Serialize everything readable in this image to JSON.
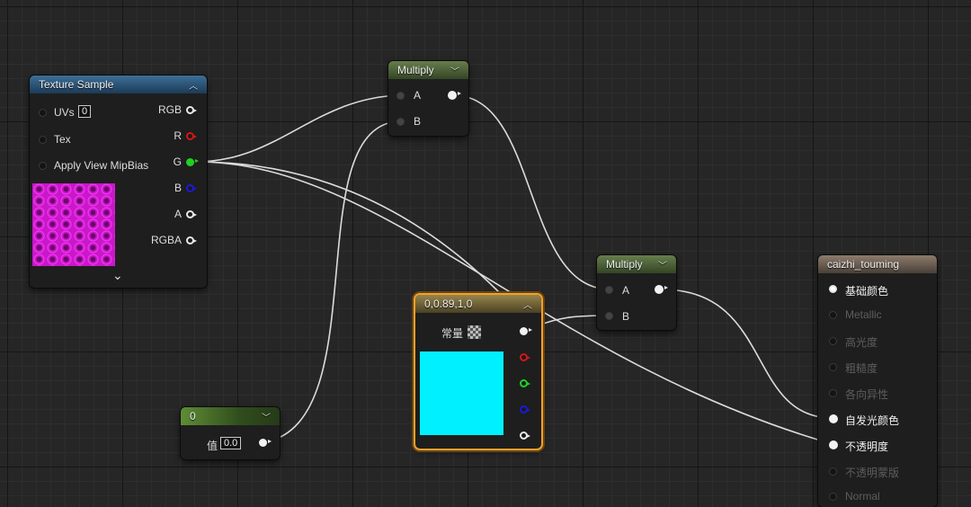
{
  "nodes": {
    "texture_sample": {
      "title": "Texture Sample",
      "inputs": [
        {
          "label": "UVs",
          "value": "0"
        },
        {
          "label": "Tex"
        },
        {
          "label": "Apply View MipBias"
        }
      ],
      "outputs": [
        "RGB",
        "R",
        "G",
        "B",
        "A",
        "RGBA"
      ],
      "preview": "hexagon-pattern-magenta",
      "expand_glyph": "⌄"
    },
    "multiply_1": {
      "title": "Multiply",
      "inputs": [
        "A",
        "B"
      ]
    },
    "multiply_2": {
      "title": "Multiply",
      "inputs": [
        "A",
        "B"
      ]
    },
    "constant_vec": {
      "title": "0,0.89,1,0",
      "param_label": "常量",
      "color": "#00f0ff"
    },
    "scalar": {
      "title": "0",
      "param_label": "值",
      "value": "0.0"
    },
    "material_output": {
      "title": "caizhi_touming",
      "pins": [
        {
          "label": "基础颜色",
          "active": true
        },
        {
          "label": "Metallic",
          "active": false
        },
        {
          "label": "高光度",
          "active": false
        },
        {
          "label": "粗糙度",
          "active": false
        },
        {
          "label": "各向异性",
          "active": false
        },
        {
          "label": "自发光颜色",
          "active": true
        },
        {
          "label": "不透明度",
          "active": true
        },
        {
          "label": "不透明蒙版",
          "active": false
        },
        {
          "label": "Normal",
          "active": false
        }
      ]
    }
  },
  "colors": {
    "channel_red": "#d01818",
    "channel_green": "#22d022",
    "channel_blue": "#1a1ad8",
    "selection": "#f0a030",
    "wire": "#dcdcdc"
  }
}
